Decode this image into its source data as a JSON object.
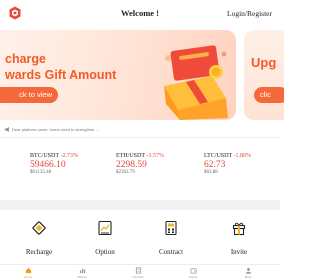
{
  "header": {
    "title": "Welcome !",
    "auth_text": "Login/Register",
    "logo_icon": "app-logo-icon"
  },
  "banner": {
    "line1": "charge",
    "line2": "wards Gift Amount",
    "button_label": "ck to view",
    "side_text": "Upg",
    "side_button": "clic",
    "accent_color": "#f25a2a",
    "image_icon": "gift-box-icon"
  },
  "notice": {
    "icon": "speaker-icon",
    "text": "Dear platform users: Users need to strengthen …"
  },
  "tickers": [
    {
      "pair": "BTC/USDT",
      "change": "-2.73%",
      "price": "59466.10",
      "usd": "$61133.48"
    },
    {
      "pair": "ETH/USDT",
      "change": "-3.57%",
      "price": "2298.59",
      "usd": "$2363.79"
    },
    {
      "pair": "LTC/USDT",
      "change": "-1.80%",
      "price": "62.73",
      "usd": "$63.88"
    }
  ],
  "shortcuts": [
    {
      "label": "Recharge",
      "icon": "recharge-diamond-icon"
    },
    {
      "label": "Option",
      "icon": "option-chart-icon"
    },
    {
      "label": "Contract",
      "icon": "contract-calculator-icon"
    },
    {
      "label": "Invite",
      "icon": "invite-gift-icon"
    }
  ],
  "tabbar": [
    {
      "label": "Home",
      "icon": "home-icon",
      "active": true
    },
    {
      "label": "Market",
      "icon": "market-icon",
      "active": false
    },
    {
      "label": "Contract",
      "icon": "contract-icon",
      "active": false
    },
    {
      "label": "Assets",
      "icon": "assets-icon",
      "active": false
    },
    {
      "label": "Mine",
      "icon": "profile-icon",
      "active": false
    }
  ],
  "colors": {
    "down": "#e0483a",
    "active_tab": "#f29c1f",
    "banner_accent": "#f4683a"
  }
}
